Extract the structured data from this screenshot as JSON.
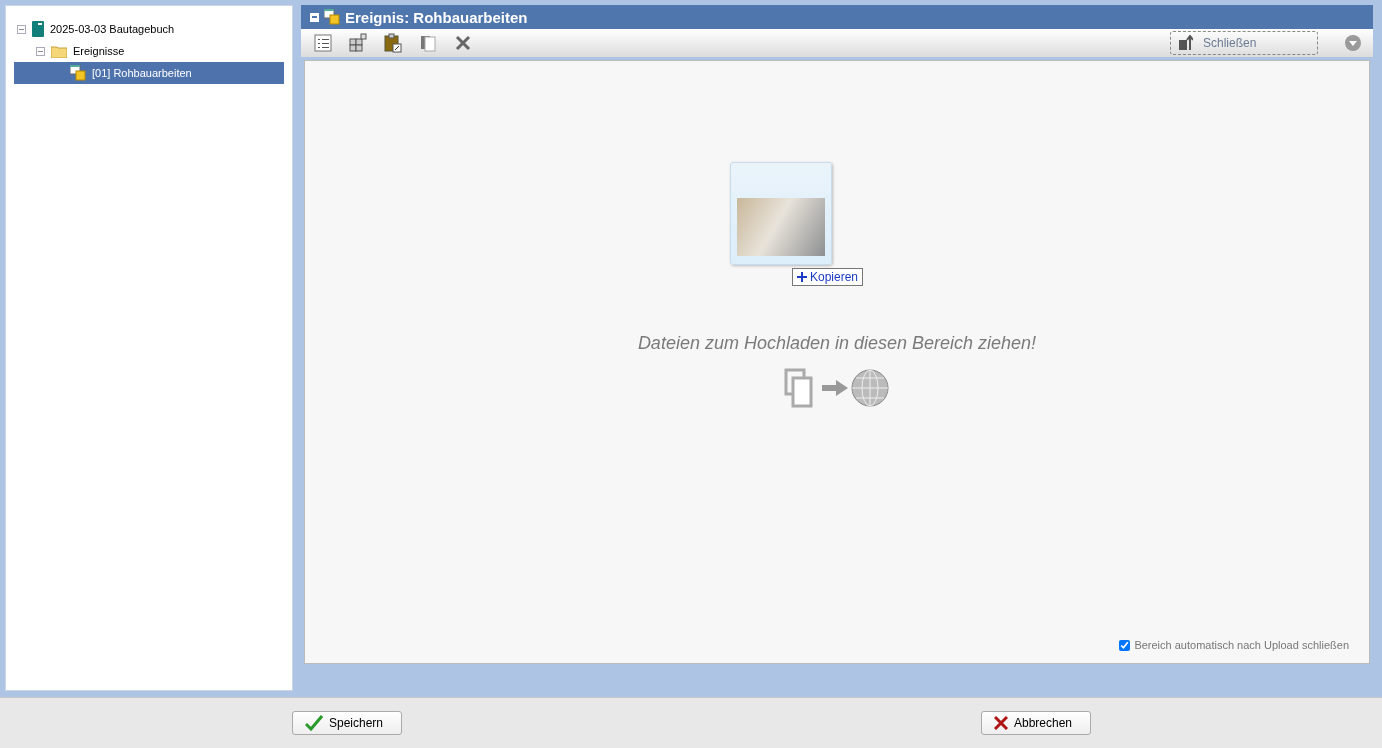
{
  "tree": [
    {
      "label": "2025-03-03 Bautagebuch",
      "kind": "book",
      "expanded": true,
      "selected": false,
      "children": [
        {
          "label": "Ereignisse",
          "kind": "folder",
          "expanded": true,
          "selected": false,
          "children": [
            {
              "label": "[01] Rohbauarbeiten",
              "kind": "event",
              "selected": true
            }
          ]
        }
      ]
    }
  ],
  "panel": {
    "title": "Ereignis: Rohbauarbeiten",
    "close_button": "Schließen"
  },
  "drop_zone": {
    "drag_label": "Kopieren",
    "message": "Dateien zum Hochladen in diesen Bereich ziehen!",
    "auto_close": {
      "label": "Bereich automatisch nach Upload schließen",
      "checked": true
    }
  },
  "buttons": [
    {
      "label": "Speichern",
      "kind": "save"
    },
    {
      "label": "Abbrechen",
      "kind": "cancel"
    }
  ]
}
